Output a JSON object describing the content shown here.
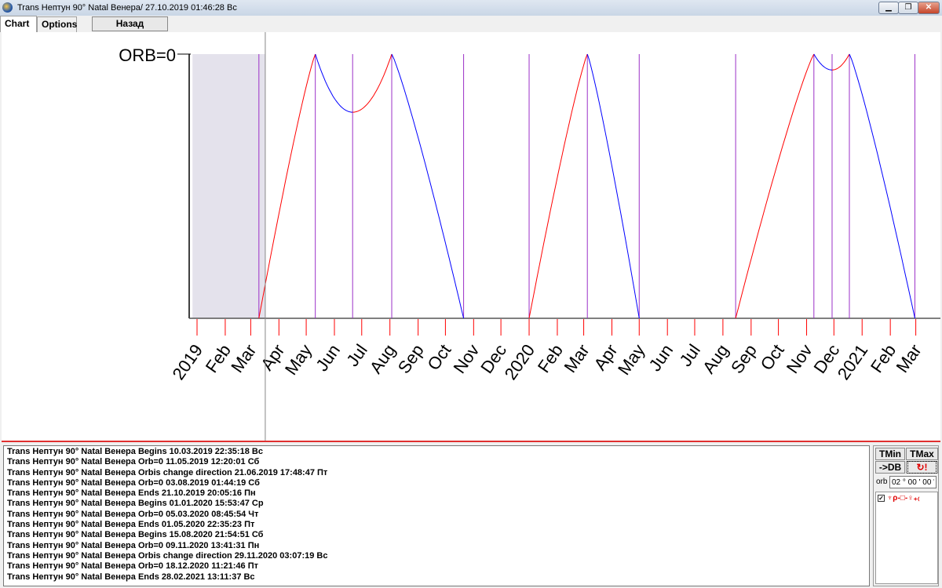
{
  "window": {
    "title": "Trans Нептун  90° Natal Венера/ 27.10.2019  01:46:28 Вс",
    "controls": [
      "minimize",
      "restore",
      "close"
    ]
  },
  "tabs": [
    {
      "label": "Chart",
      "active": true
    },
    {
      "label": "Options",
      "active": false
    }
  ],
  "back_button": "Назад",
  "chart_data": {
    "type": "line",
    "ylabel_top": "ORB=0",
    "orb_max_deg": 2,
    "x_ticks": [
      {
        "date": "2019-01-01",
        "label": "2019"
      },
      {
        "date": "2019-02-01",
        "label": "Feb"
      },
      {
        "date": "2019-03-01",
        "label": "Mar"
      },
      {
        "date": "2019-04-01",
        "label": "Apr"
      },
      {
        "date": "2019-05-01",
        "label": "May"
      },
      {
        "date": "2019-06-01",
        "label": "Jun"
      },
      {
        "date": "2019-07-01",
        "label": "Jul"
      },
      {
        "date": "2019-08-01",
        "label": "Aug"
      },
      {
        "date": "2019-09-01",
        "label": "Sep"
      },
      {
        "date": "2019-10-01",
        "label": "Oct"
      },
      {
        "date": "2019-11-01",
        "label": "Nov"
      },
      {
        "date": "2019-12-01",
        "label": "Dec"
      },
      {
        "date": "2020-01-01",
        "label": "2020"
      },
      {
        "date": "2020-02-01",
        "label": "Feb"
      },
      {
        "date": "2020-03-01",
        "label": "Mar"
      },
      {
        "date": "2020-04-01",
        "label": "Apr"
      },
      {
        "date": "2020-05-01",
        "label": "May"
      },
      {
        "date": "2020-06-01",
        "label": "Jun"
      },
      {
        "date": "2020-07-01",
        "label": "Jul"
      },
      {
        "date": "2020-08-01",
        "label": "Aug"
      },
      {
        "date": "2020-09-01",
        "label": "Sep"
      },
      {
        "date": "2020-10-01",
        "label": "Oct"
      },
      {
        "date": "2020-11-01",
        "label": "Nov"
      },
      {
        "date": "2020-12-01",
        "label": "Dec"
      },
      {
        "date": "2021-01-01",
        "label": "2021"
      },
      {
        "date": "2021-02-01",
        "label": "Feb"
      },
      {
        "date": "2021-03-01",
        "label": "Mar"
      }
    ],
    "x_range": [
      "2018-12-22",
      "2021-03-24"
    ],
    "shaded_range": [
      "2018-12-27",
      "2019-03-17"
    ],
    "cursor_date": "2019-03-17",
    "points": [
      {
        "date": "2019-03-10",
        "orb": 2
      },
      {
        "date": "2019-05-11",
        "orb": 0
      },
      {
        "date": "2019-06-21",
        "orb": 0.44
      },
      {
        "date": "2019-08-03",
        "orb": 0
      },
      {
        "date": "2019-10-21",
        "orb": 2
      },
      {
        "date": "2020-01-01",
        "orb": 2
      },
      {
        "date": "2020-03-05",
        "orb": 0
      },
      {
        "date": "2020-05-01",
        "orb": 2
      },
      {
        "date": "2020-08-15",
        "orb": 2
      },
      {
        "date": "2020-11-09",
        "orb": 0
      },
      {
        "date": "2020-11-29",
        "orb": 0.12
      },
      {
        "date": "2020-12-18",
        "orb": 0
      },
      {
        "date": "2021-02-28",
        "orb": 2
      }
    ],
    "passes": [
      [
        0,
        1,
        2,
        3,
        4
      ],
      [
        5,
        6,
        7
      ],
      [
        8,
        9,
        10,
        11,
        12
      ]
    ],
    "colors": {
      "applying": "#ff0000",
      "separating": "#0000ff",
      "event_line": "#9b30c8",
      "tick": "#ff0000",
      "shade": "#e4e2ec"
    }
  },
  "log": [
    "Trans Нептун  90° Natal Венера Begins 10.03.2019  22:35:18 Вс",
    "Trans Нептун  90° Natal Венера Orb=0 11.05.2019  12:20:01 Сб",
    "Trans Нептун  90° Natal Венера Orbis change direction 21.06.2019  17:48:47 Пт",
    "Trans Нептун  90° Natal Венера Orb=0 03.08.2019  01:44:19 Сб",
    "Trans Нептун  90° Natal Венера Ends 21.10.2019  20:05:16 Пн",
    "Trans Нептун  90° Natal Венера Begins 01.01.2020  15:53:47 Ср",
    "Trans Нептун  90° Natal Венера Orb=0 05.03.2020  08:45:54 Чт",
    "Trans Нептун  90° Natal Венера Ends 01.05.2020  22:35:23 Пт",
    "Trans Нептун  90° Natal Венера Begins 15.08.2020  21:54:51 Сб",
    "Trans Нептун  90° Natal Венера Orb=0 09.11.2020  13:41:31 Пн",
    "Trans Нептун  90° Natal Венера Orbis change direction 29.11.2020  03:07:19 Вс",
    "Trans Нептун  90° Natal Венера Orb=0 18.12.2020  11:21:46 Пт",
    "Trans Нептун  90° Natal Венера Ends 28.02.2021  13:11:37 Вс"
  ],
  "side": {
    "tmin": "TMin",
    "tmax": "TMax",
    "todb": "->DB",
    "refresh_icon": "refresh-alert-icon",
    "orb_label": "orb",
    "orb_value": "02 ° 00 ' 00 \"",
    "aspect": {
      "checked": true,
      "label": "♆ρ-□-♀₊₍"
    }
  }
}
